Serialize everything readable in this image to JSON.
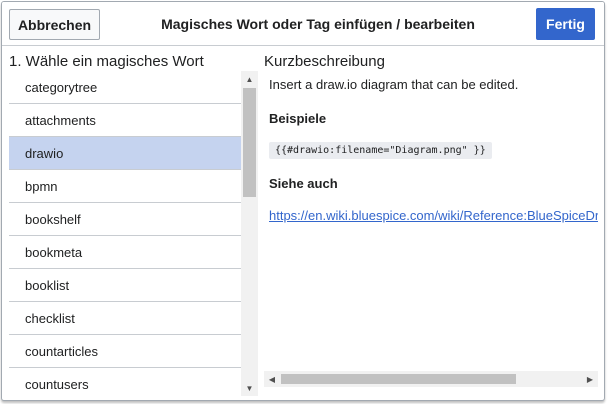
{
  "header": {
    "cancel_label": "Abbrechen",
    "title": "Magisches Wort oder Tag einfügen / bearbeiten",
    "done_label": "Fertig"
  },
  "left_panel": {
    "heading": "1. Wähle ein magisches Wort",
    "items": [
      {
        "label": "categorytree"
      },
      {
        "label": "attachments"
      },
      {
        "label": "drawio",
        "selected": true
      },
      {
        "label": "bpmn"
      },
      {
        "label": "bookshelf"
      },
      {
        "label": "bookmeta"
      },
      {
        "label": "booklist"
      },
      {
        "label": "checklist"
      },
      {
        "label": "countarticles"
      },
      {
        "label": "countusers"
      }
    ]
  },
  "right_panel": {
    "heading": "Kurzbeschreibung",
    "description": "Insert a draw.io diagram that can be edited.",
    "examples_heading": "Beispiele",
    "example_code": "{{#drawio:filename=\"Diagram.png\" }}",
    "see_also_heading": "Siehe auch",
    "see_also_link": "https://en.wiki.bluespice.com/wiki/Reference:BlueSpiceDrawioConnector"
  },
  "colors": {
    "primary": "#3366cc",
    "selected_row": "#c5d3ef",
    "border": "#c8ccd1"
  }
}
